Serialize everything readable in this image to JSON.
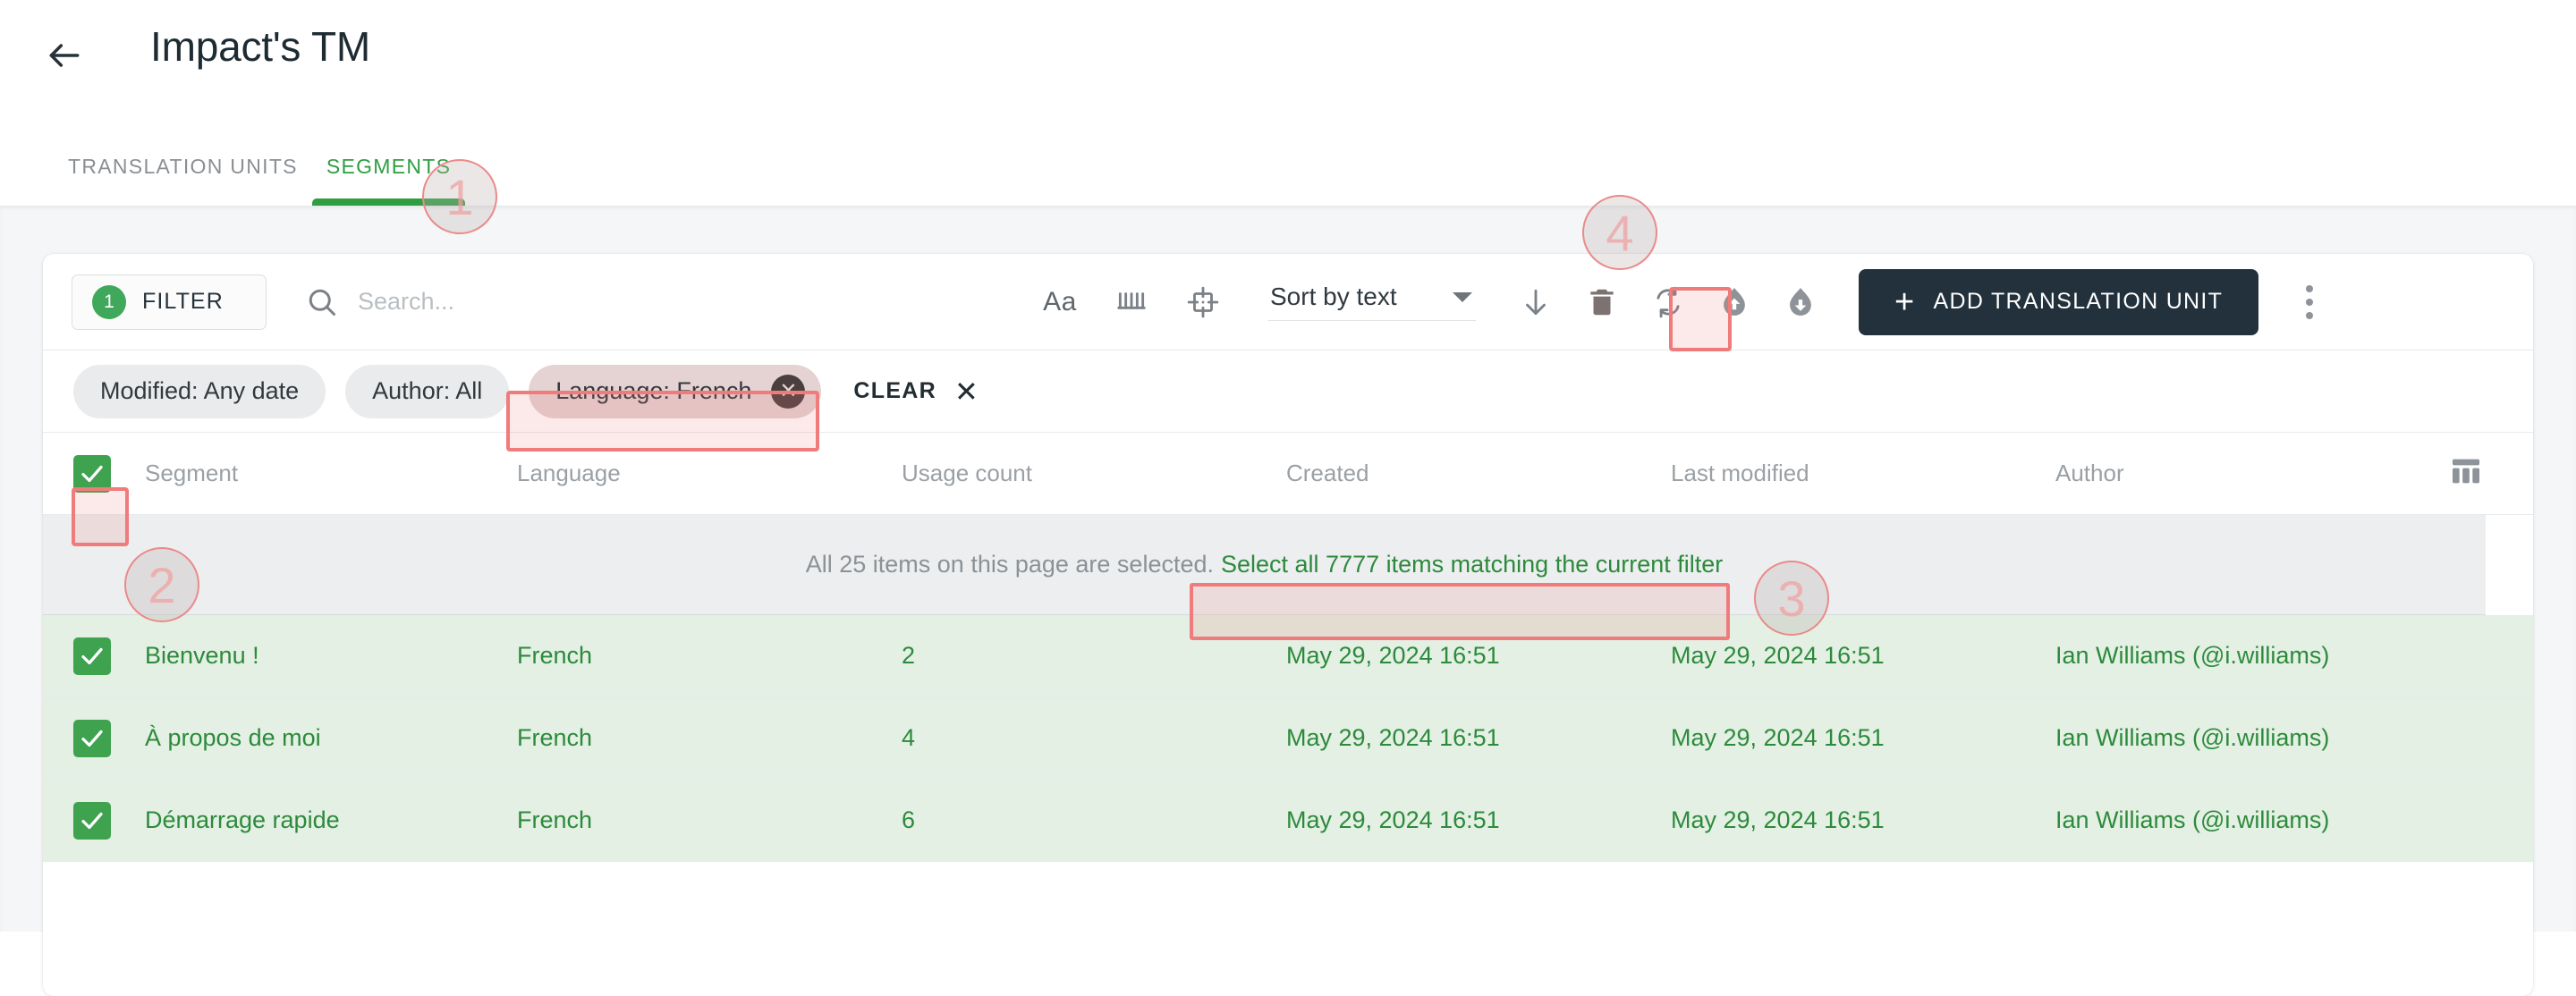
{
  "header": {
    "back_icon": "arrow-left-icon",
    "title": "Impact's TM"
  },
  "tabs": [
    {
      "label": "TRANSLATION UNITS",
      "active": false
    },
    {
      "label": "SEGMENTS",
      "active": true
    }
  ],
  "toolbar": {
    "filter_count": "1",
    "filter_label": "FILTER",
    "search_placeholder": "Search...",
    "search_value": "",
    "search_icon": "search-icon",
    "icons": [
      {
        "name": "match-case-icon",
        "glyph": "Aa"
      },
      {
        "name": "whitespace-icon",
        "glyph": ""
      },
      {
        "name": "regex-icon",
        "glyph": ""
      }
    ],
    "sort_label": "Sort by text",
    "sort_direction_icon": "arrow-down-icon",
    "delete_icon": "trash-icon",
    "refresh_icon": "refresh-search-icon",
    "upload_icon": "upload-icon",
    "download_icon": "download-icon",
    "add_button_label": "ADD TRANSLATION UNIT",
    "add_button_plus": "+",
    "more_icon": "kebab-menu-icon"
  },
  "filters": {
    "chips": [
      {
        "label": "Modified: Any date",
        "selected": false
      },
      {
        "label": "Author: All",
        "selected": false
      },
      {
        "label": "Language: French",
        "selected": true
      }
    ],
    "clear_label": "CLEAR",
    "clear_x": "✕"
  },
  "table": {
    "columns": [
      "Segment",
      "Language",
      "Usage count",
      "Created",
      "Last modified",
      "Author"
    ],
    "column_settings_icon": "columns-settings-icon",
    "header_checkbox_checked": true,
    "banner": {
      "text": "All 25 items on this page are selected.",
      "link": "Select all 7777 items matching the current filter"
    },
    "rows": [
      {
        "checked": true,
        "segment": "Bienvenu !",
        "language": "French",
        "usage_count": "2",
        "created": "May 29, 2024 16:51",
        "last_modified": "May 29, 2024 16:51",
        "author": "Ian Williams (@i.williams)"
      },
      {
        "checked": true,
        "segment": "À propos de moi",
        "language": "French",
        "usage_count": "4",
        "created": "May 29, 2024 16:51",
        "last_modified": "May 29, 2024 16:51",
        "author": "Ian Williams (@i.williams)"
      },
      {
        "checked": true,
        "segment": "Démarrage rapide",
        "language": "French",
        "usage_count": "6",
        "created": "May 29, 2024 16:51",
        "last_modified": "May 29, 2024 16:51",
        "author": "Ian Williams (@i.williams)"
      }
    ]
  },
  "annotations": [
    {
      "number": "1"
    },
    {
      "number": "2"
    },
    {
      "number": "3"
    },
    {
      "number": "4"
    }
  ],
  "colors": {
    "accent_green": "#2e9e41",
    "row_green_bg": "#e3f0e3",
    "row_green_text": "#2d8a3c",
    "dark_button": "#22313c",
    "highlight_red": "#ef7b7b",
    "chip_bg": "#e9ebec",
    "chip_selected_bg": "#e5d2d2"
  }
}
